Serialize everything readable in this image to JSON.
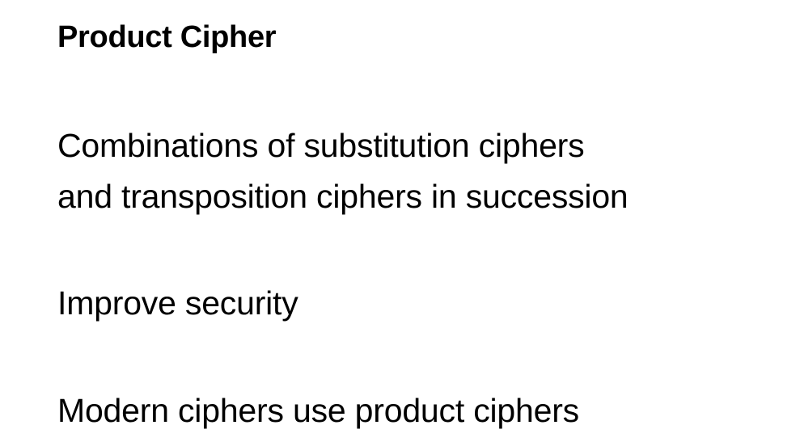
{
  "slide": {
    "title": "Product Cipher",
    "points": [
      {
        "lines": [
          "Combinations of substitution ciphers",
          "and transposition ciphers in succession"
        ]
      },
      {
        "lines": [
          "Improve security"
        ]
      },
      {
        "lines": [
          "Modern ciphers use product ciphers"
        ]
      }
    ]
  }
}
